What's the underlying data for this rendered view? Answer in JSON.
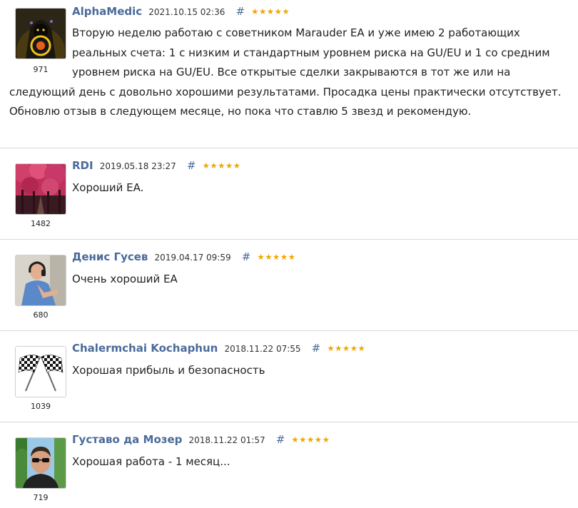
{
  "reviews": [
    {
      "author": "AlphaMedic",
      "date": "2021.10.15 02:36",
      "hash": "#",
      "stars": "★★★★★",
      "rating": "971",
      "avatar_icon": "hooded-figure-icon",
      "lines": [
        "Вторую неделю работаю с советником Marauder EA и уже имею 2 работающих",
        "реальных счета: 1 с низким и стандартным уровнем риска на GU/EU и 1 со средним",
        "уровнем риска на GU/EU. Все открытые сделки закрываются в тот же или на",
        "следующий день с довольно хорошими результатами. Просадка цены практически отсутствует.",
        "Обновлю отзыв в следующем месяце, но пока что ставлю 5 звезд и рекомендую."
      ]
    },
    {
      "author": "RDI",
      "date": "2019.05.18 23:27",
      "hash": "#",
      "stars": "★★★★★",
      "rating": "1482",
      "avatar_icon": "pink-trees-avatar",
      "lines": [
        "Хороший EA."
      ]
    },
    {
      "author": "Денис Гусев",
      "date": "2019.04.17 09:59",
      "hash": "#",
      "stars": "★★★★★",
      "rating": "680",
      "avatar_icon": "dj-headphones-avatar",
      "lines": [
        "Очень хороший EA"
      ]
    },
    {
      "author": "Chalermchai Kochaphun",
      "date": "2018.11.22 07:55",
      "hash": "#",
      "stars": "★★★★★",
      "rating": "1039",
      "avatar_icon": "checkered-flags-icon",
      "lines": [
        "Хорошая прибыль и безопасность"
      ]
    },
    {
      "author": "Густаво да Мозер",
      "date": "2018.11.22 01:57",
      "hash": "#",
      "stars": "★★★★★",
      "rating": "719",
      "avatar_icon": "man-sunglasses-avatar",
      "lines": [
        "Хорошая работа - 1 месяц..."
      ]
    }
  ]
}
